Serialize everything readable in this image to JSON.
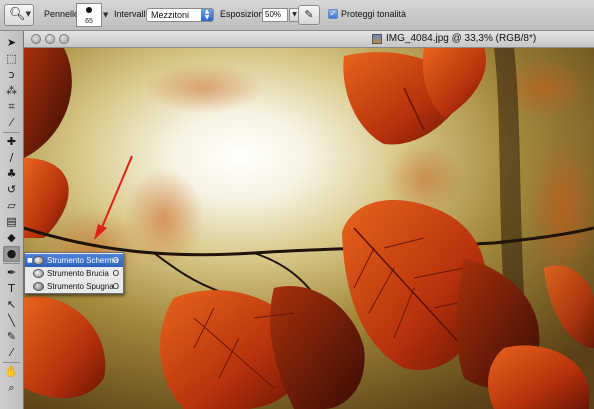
{
  "options_bar": {
    "tool_preset_icon": "dodge-tool-icon",
    "brush_label": "Pennello:",
    "brush_size": "65",
    "range_label": "Intervallo:",
    "range_value": "Mezzitoni",
    "exposure_label": "Esposizione:",
    "exposure_value": "50%",
    "airbrush_icon": "airbrush-icon",
    "protect_tones_label": "Proteggi tonalità",
    "protect_tones_checked": true
  },
  "document": {
    "title": "IMG_4084.jpg @ 33,3% (RGB/8*)"
  },
  "tools_panel": {
    "tools": [
      {
        "name": "move-tool-icon",
        "glyph": "➤"
      },
      {
        "name": "marquee-tool-icon",
        "glyph": "⬚"
      },
      {
        "name": "lasso-tool-icon",
        "glyph": "ↄ"
      },
      {
        "name": "magic-wand-tool-icon",
        "glyph": "⁂"
      },
      {
        "name": "crop-tool-icon",
        "glyph": "⌗"
      },
      {
        "name": "eyedropper-tool-icon",
        "glyph": "⁄"
      },
      {
        "name": "healing-brush-tool-icon",
        "glyph": "✚"
      },
      {
        "name": "brush-tool-icon",
        "glyph": "∕"
      },
      {
        "name": "clone-stamp-tool-icon",
        "glyph": "♣"
      },
      {
        "name": "history-brush-tool-icon",
        "glyph": "↺"
      },
      {
        "name": "eraser-tool-icon",
        "glyph": "▱"
      },
      {
        "name": "gradient-tool-icon",
        "glyph": "▤"
      },
      {
        "name": "blur-tool-icon",
        "glyph": "◆"
      },
      {
        "name": "dodge-tool-icon",
        "glyph": "●"
      },
      {
        "name": "pen-tool-icon",
        "glyph": "✒"
      },
      {
        "name": "type-tool-icon",
        "glyph": "T"
      },
      {
        "name": "path-selection-tool-icon",
        "glyph": "↖"
      },
      {
        "name": "line-tool-icon",
        "glyph": "╲"
      },
      {
        "name": "notes-tool-icon",
        "glyph": "✎"
      },
      {
        "name": "eyedropper2-tool-icon",
        "glyph": "⁄"
      },
      {
        "name": "hand-tool-icon",
        "glyph": "✋"
      },
      {
        "name": "zoom-tool-icon",
        "glyph": "⌕"
      }
    ]
  },
  "flyout": {
    "items": [
      {
        "label": "Strumento Scherma",
        "shortcut": "O",
        "icon": "dodge-icon",
        "selected": true
      },
      {
        "label": "Strumento Brucia",
        "shortcut": "O",
        "icon": "burn-icon",
        "selected": false
      },
      {
        "label": "Strumento Spugna",
        "shortcut": "O",
        "icon": "sponge-icon",
        "selected": false
      }
    ]
  },
  "annotation": {
    "arrow_color": "#e0201a"
  },
  "colors": {
    "selection_blue": "#2b5fbd",
    "leaf_orange": "#c8400e"
  }
}
